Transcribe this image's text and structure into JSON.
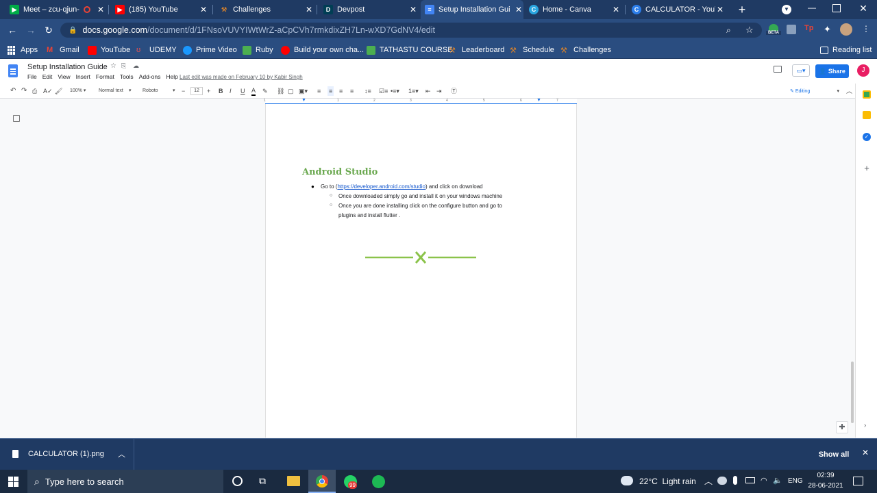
{
  "tabs": [
    {
      "title": "Meet – zcu-qjun-",
      "favicon": "meet-icon",
      "color": "#00ac47"
    },
    {
      "title": "(185) YouTube",
      "favicon": "youtube-icon",
      "color": "#ff0000"
    },
    {
      "title": "Challenges",
      "favicon": "hackerrank-icon",
      "color": "#d9822b"
    },
    {
      "title": "Devpost",
      "favicon": "devpost-icon",
      "color": "#003e54"
    },
    {
      "title": "Setup Installation Gui",
      "favicon": "docs-icon",
      "color": "#4285f4"
    },
    {
      "title": "Home - Canva",
      "favicon": "canva-icon",
      "color": "#2aa6e0"
    },
    {
      "title": "CALCULATOR - YouTu",
      "favicon": "canva-c-icon",
      "color": "#2b7de9"
    }
  ],
  "omnibox": {
    "host": "docs.google.com",
    "path": "/document/d/1FNsoVUVYIWtWrZ-aCpCVh7rmkdixZH7Ln-wXD7GdNV4/edit"
  },
  "extensions": {
    "beta_label": "BETA"
  },
  "bookmarks": {
    "apps": "Apps",
    "items": [
      {
        "label": "Gmail",
        "color": "#ea4335"
      },
      {
        "label": "YouTube",
        "color": "#ff0000"
      },
      {
        "label": "UDEMY",
        "color": "#ec5252"
      },
      {
        "label": "Prime Video",
        "color": "#1a98ff"
      },
      {
        "label": "Ruby",
        "color": "#4caf50"
      },
      {
        "label": "Build your own cha...",
        "color": "#ff0000"
      },
      {
        "label": "TATHASTU COURSE",
        "color": "#4caf50"
      },
      {
        "label": "Leaderboard",
        "color": "#d9822b"
      },
      {
        "label": "Schedule",
        "color": "#d9822b"
      },
      {
        "label": "Challenges",
        "color": "#d9822b"
      }
    ],
    "reading_list": "Reading list"
  },
  "doc": {
    "title": "Setup Installation Guide",
    "menu": [
      "File",
      "Edit",
      "View",
      "Insert",
      "Format",
      "Tools",
      "Add-ons",
      "Help"
    ],
    "last_edit": "Last edit was made on February 10 by Kabir Singh",
    "share": "Share",
    "avatar": "J",
    "toolbar": {
      "zoom": "100%",
      "style": "Normal text",
      "font": "Roboto",
      "size": "12",
      "mode": "Editing"
    },
    "ruler_marks": [
      "1",
      "1",
      "2",
      "3",
      "4",
      "5",
      "6",
      "7"
    ],
    "heading": "Android Studio",
    "bullet1_pre": "Go to (",
    "bullet1_link": "https://developer.android.com/studio",
    "bullet1_post": ") and click on download",
    "sub1": "Once downloaded simply go and install it on your windows machine",
    "sub2_line1": "Once you are done installing click on the configure button and go to",
    "sub2_line2": "plugins and install flutter ."
  },
  "colors": {
    "accent_green": "#6aa84f",
    "divider_green": "#8bc34a",
    "link": "#1155cc",
    "share_blue": "#1a73e8",
    "avatar_pink": "#e91e63"
  },
  "download": {
    "file": "CALCULATOR (1).png",
    "show_all": "Show all"
  },
  "taskbar": {
    "search_placeholder": "Type here to search",
    "weather": "22°C  Light rain",
    "lang": "ENG",
    "time": "02:39",
    "date": "28-06-2021",
    "whatsapp_badge": "99"
  }
}
